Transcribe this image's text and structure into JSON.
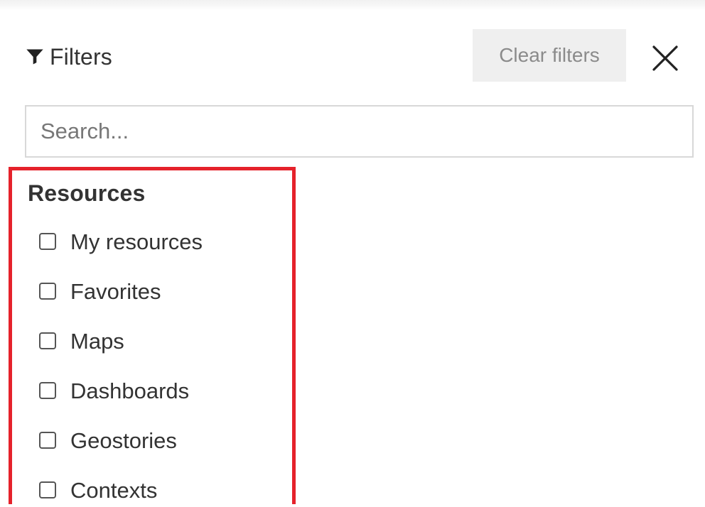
{
  "header": {
    "title": "Filters",
    "icon": "filter-icon",
    "clear_label": "Clear filters",
    "close_icon": "close-icon"
  },
  "search": {
    "placeholder": "Search..."
  },
  "resources": {
    "title": "Resources",
    "items": [
      {
        "label": "My resources",
        "checked": false
      },
      {
        "label": "Favorites",
        "checked": false
      },
      {
        "label": "Maps",
        "checked": false
      },
      {
        "label": "Dashboards",
        "checked": false
      },
      {
        "label": "Geostories",
        "checked": false
      },
      {
        "label": "Contexts",
        "checked": false
      }
    ]
  },
  "colors": {
    "highlight": "#e5222b",
    "clear_button_bg": "#efefef",
    "clear_button_text": "#8b8b8b",
    "text": "#333333",
    "border": "#d8d8d8"
  }
}
